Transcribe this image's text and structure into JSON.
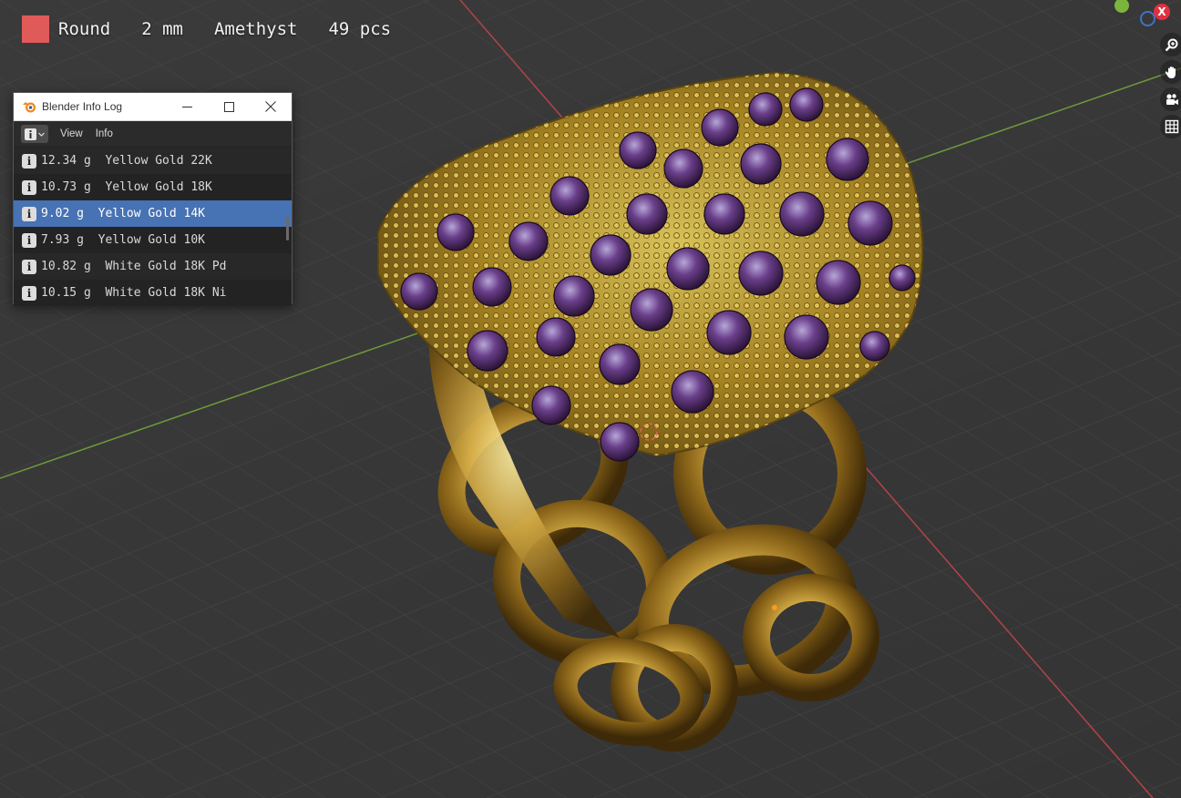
{
  "overlay": {
    "shape": "Round",
    "size": "2 mm",
    "gem": "Amethyst",
    "count": "49 pcs",
    "swatch_color": "#e05a5a"
  },
  "axes": {
    "x_color": "#b4434a",
    "y_color": "#6e9a3a"
  },
  "gizmo": {
    "x_label": "X",
    "nav_icons": [
      "zoom-icon",
      "hand-pan-icon",
      "camera-icon",
      "grid-view-icon"
    ]
  },
  "info_window": {
    "title": "Blender Info Log",
    "menu": {
      "view": "View",
      "info": "Info"
    },
    "rows": [
      {
        "text": "12.34 g  Yellow Gold 22K",
        "selected": false
      },
      {
        "text": "10.73 g  Yellow Gold 18K",
        "selected": false
      },
      {
        "text": "9.02 g  Yellow Gold 14K",
        "selected": true
      },
      {
        "text": "7.93 g  Yellow Gold 10K",
        "selected": false
      },
      {
        "text": "10.82 g  White Gold 18K Pd",
        "selected": false
      },
      {
        "text": "10.15 g  White Gold 18K Ni",
        "selected": false
      }
    ],
    "info_glyph": "i"
  }
}
